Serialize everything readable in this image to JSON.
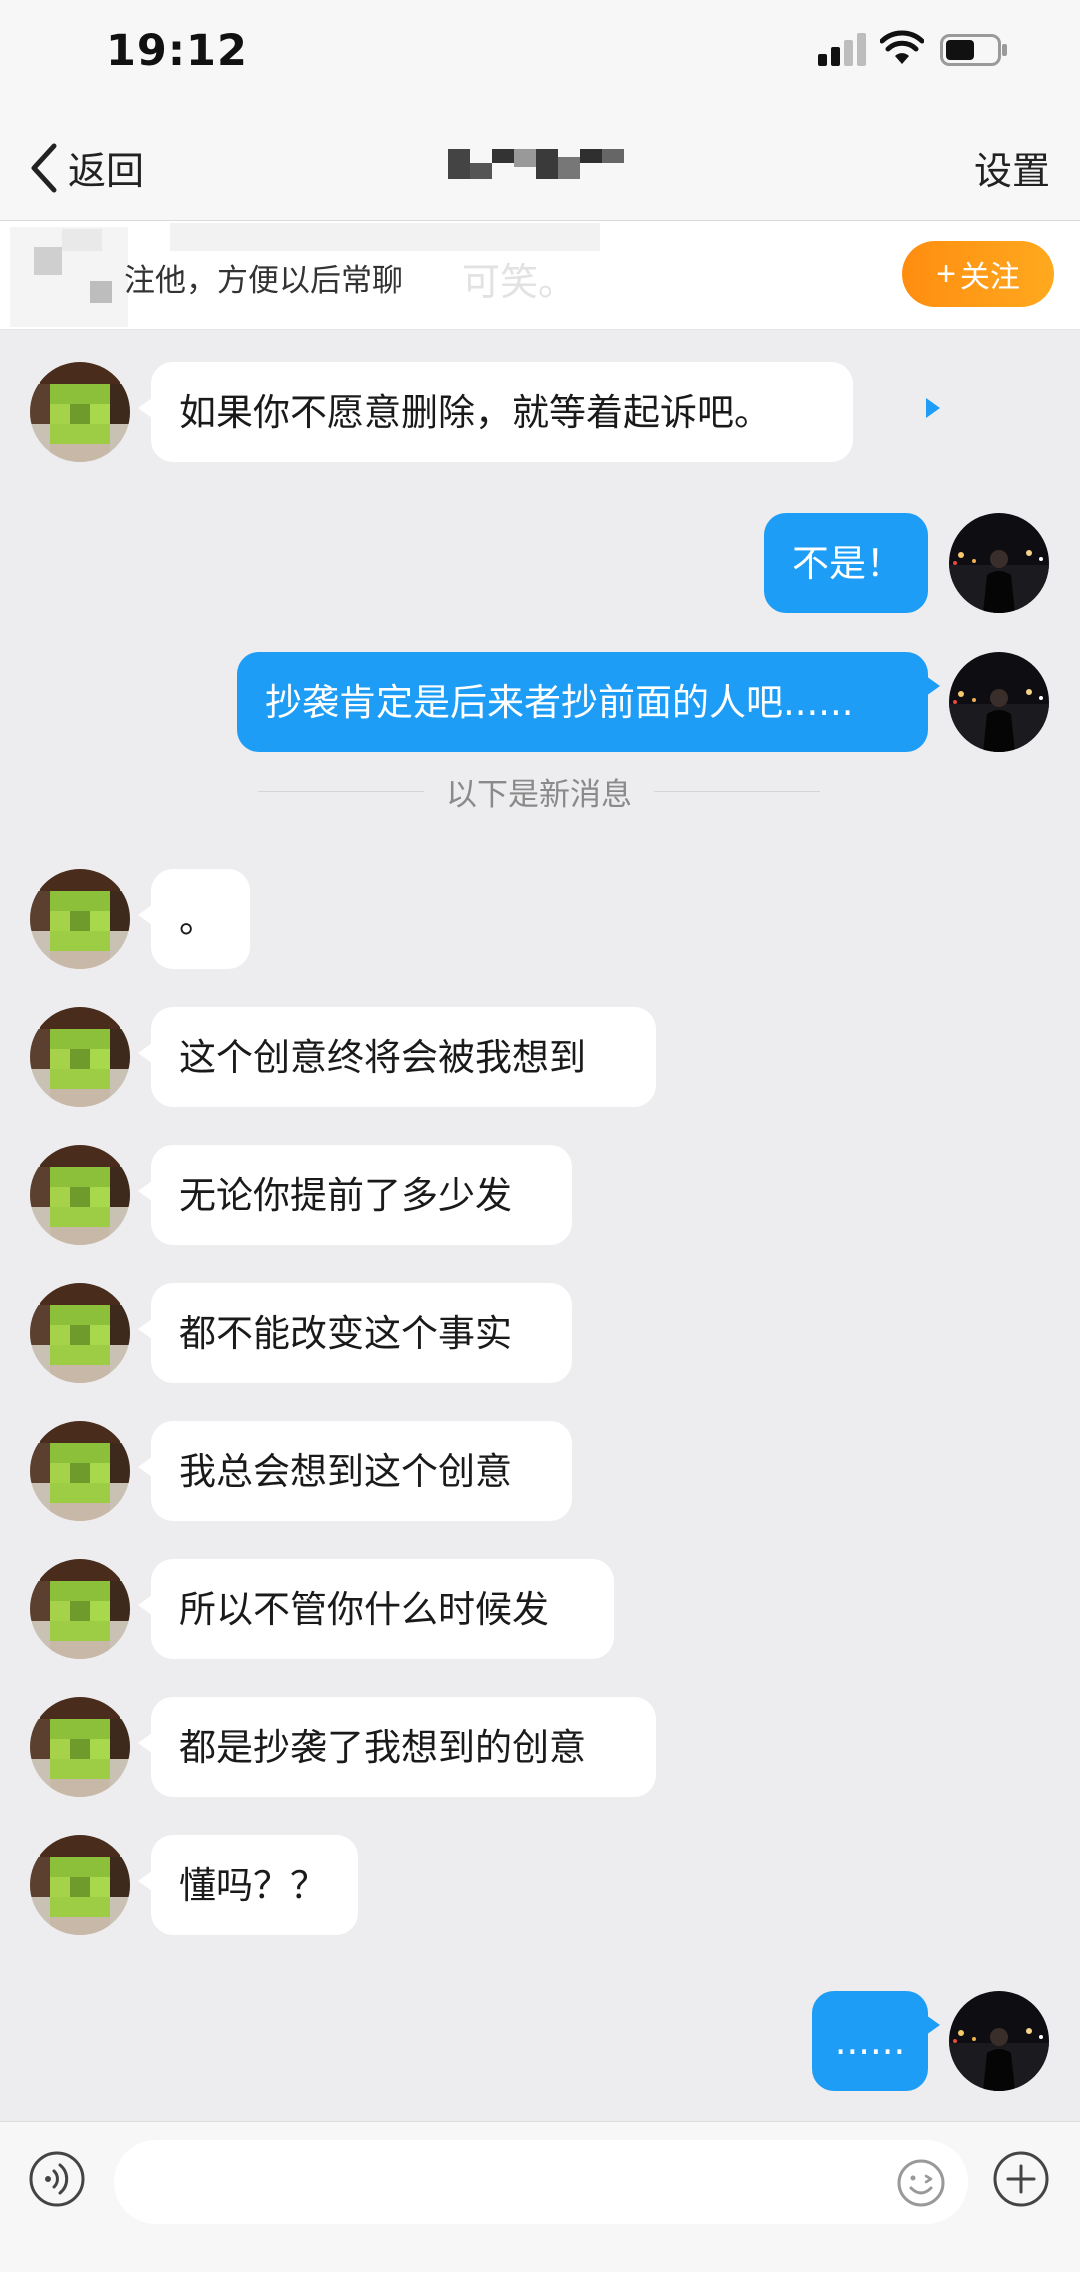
{
  "status_bar": {
    "time": "19:12"
  },
  "nav": {
    "back_label": "返回",
    "title": "",
    "settings_label": "设置"
  },
  "follow_bar": {
    "text": "注他，方便以后常聊",
    "ghost_text": "可笑。",
    "button_label": "关注"
  },
  "messages": [
    {
      "side": "in",
      "text": "如果你不愿意删除，就等着起诉吧。"
    },
    {
      "side": "out",
      "text": "不是！"
    },
    {
      "side": "out",
      "text": "抄袭肯定是后来者抄前面的人吧......"
    },
    {
      "side": "divider",
      "text": "以下是新消息"
    },
    {
      "side": "in",
      "text": "。"
    },
    {
      "side": "in",
      "text": "这个创意终将会被我想到"
    },
    {
      "side": "in",
      "text": "无论你提前了多少发"
    },
    {
      "side": "in",
      "text": "都不能改变这个事实"
    },
    {
      "side": "in",
      "text": "我总会想到这个创意"
    },
    {
      "side": "in",
      "text": "所以不管你什么时候发"
    },
    {
      "side": "in",
      "text": "都是抄袭了我想到的创意"
    },
    {
      "side": "in",
      "text": "懂吗？？"
    },
    {
      "side": "out",
      "text": "......"
    }
  ],
  "input": {
    "placeholder": ""
  },
  "icons": {
    "back": "chevron-left-icon",
    "voice": "voice-icon",
    "emoji": "emoji-icon",
    "plus": "plus-icon"
  },
  "colors": {
    "accent_blue": "#1e9df6",
    "follow_orange": "#ff9a16",
    "background": "#ededf0"
  }
}
